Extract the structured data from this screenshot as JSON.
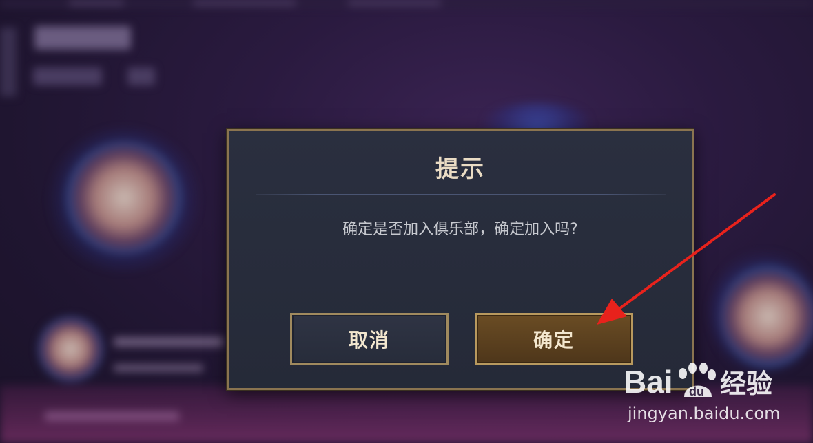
{
  "dialog": {
    "title": "提示",
    "message": "确定是否加入俱乐部，确定加入吗?",
    "cancel_label": "取消",
    "confirm_label": "确定"
  },
  "colors": {
    "dialog_border": "#8a7450",
    "confirm_bg": "#5c4120",
    "title_text": "#eadcc4",
    "arrow": "#e8221c"
  },
  "watermark": {
    "logo_text": "Bai du 经验",
    "url": "jingyan.baidu.com"
  }
}
